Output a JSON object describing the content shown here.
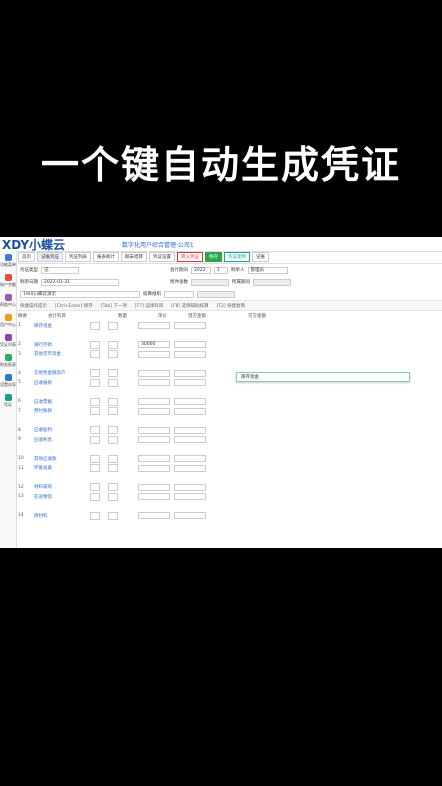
{
  "headline": "一个键自动生成凭证",
  "app": {
    "logo": "XDY小蝶云",
    "company": "数字化用户综合管理·公司1"
  },
  "sidebar": [
    {
      "label": "功能菜单",
      "color": "#3a7bd5"
    },
    {
      "label": "账户余额",
      "color": "#e74c3c"
    },
    {
      "label": "帮助中心",
      "color": "#9b59b6"
    },
    {
      "label": "用户中心",
      "color": "#f39c12"
    },
    {
      "label": "凭证列表",
      "color": "#8e44ad"
    },
    {
      "label": "财务报表",
      "color": "#27ae60"
    },
    {
      "label": "设置向导",
      "color": "#2980b9"
    },
    {
      "label": "凭证",
      "color": "#16a085"
    }
  ],
  "toolbar": [
    "首页",
    "记账凭证",
    "凭证列表",
    "报表统计",
    "期末结转",
    "凭证设置",
    "转入凭证",
    "保存",
    "凭证复制",
    "记账"
  ],
  "form": {
    "type_label": "凭证类型",
    "type_value": "记",
    "number_label": "会计期间",
    "year": "2022",
    "month": "1",
    "date_label": "制单日期",
    "date_value": "2022-01-31",
    "attach_label": "附件张数",
    "period_label": "所属期间",
    "maker_label": "制单人",
    "maker_value": "管理员",
    "org_label": "核算组织",
    "org_value": "19(01)蝶云演示"
  },
  "tips": [
    "快捷操作提示",
    "[Ctrl+Enter] 保存",
    "[Tab] 下一项",
    "[F7] 选择科目",
    "[F8] 选择辅助核算",
    "[F2] 快捷复制"
  ],
  "grid": {
    "headers": [
      "摘要",
      "会计科目",
      "数量",
      "单价",
      "借方金额",
      "贷方金额"
    ],
    "rows": [
      {
        "no": "1",
        "name": "库存现金"
      },
      {
        "no": "2",
        "name": "银行存款"
      },
      {
        "no": "3",
        "name": "其他货币资金"
      },
      {
        "no": "4",
        "name": "交易性金融资产"
      },
      {
        "no": "5",
        "name": "应收账款"
      },
      {
        "no": "6",
        "name": "应收票据"
      },
      {
        "no": "7",
        "name": "预付账款"
      },
      {
        "no": "8",
        "name": "应收股利"
      },
      {
        "no": "9",
        "name": "应收利息"
      },
      {
        "no": "10",
        "name": "其他应收款"
      },
      {
        "no": "11",
        "name": "坏账准备"
      },
      {
        "no": "12",
        "name": "材料采购"
      },
      {
        "no": "13",
        "name": "在途物资"
      },
      {
        "no": "14",
        "name": "原材料"
      }
    ],
    "amount_value": "30000",
    "dropdown_text": "库存现金"
  }
}
